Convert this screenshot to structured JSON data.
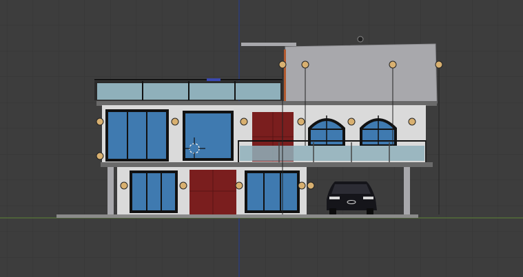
{
  "viewport": {
    "mode": "front-orthographic",
    "background": "#3d3d3d",
    "grid_color": "#353535",
    "x_axis_color": "#5a7a3a",
    "z_axis_color": "#2a3f8a"
  },
  "scene": {
    "building": {
      "floors": 2,
      "wall_color": "#dadada",
      "tower_color": "#a8a8ac",
      "window_color": "#3f7ab0",
      "frame_color": "#111111",
      "door_color": "#7a1e1e",
      "railing_glass_color": "#8fb0bb",
      "lamp_color": "#d8b070"
    },
    "car": {
      "color": "#15151a",
      "logo_color": "#d8d8d8"
    }
  }
}
